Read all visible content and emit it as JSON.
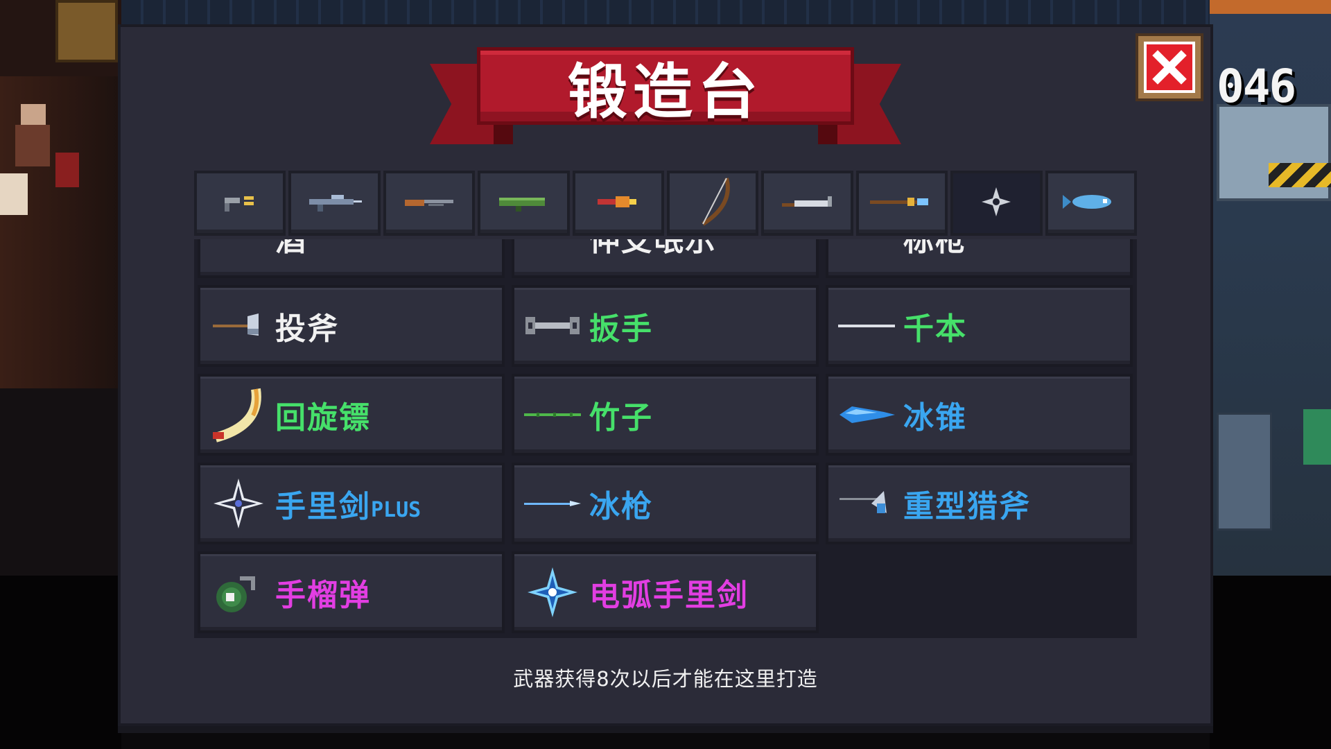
{
  "background": {
    "counter_text": "046"
  },
  "title": "锻造台",
  "close_icon": "close-x-icon",
  "tabs": [
    {
      "icon": "pistol-icon",
      "active": false
    },
    {
      "icon": "rifle-icon",
      "active": false
    },
    {
      "icon": "shotgun-icon",
      "active": false
    },
    {
      "icon": "launcher-icon",
      "active": false
    },
    {
      "icon": "staff-icon",
      "active": false
    },
    {
      "icon": "bow-icon",
      "active": false
    },
    {
      "icon": "sword-icon",
      "active": false
    },
    {
      "icon": "spear-icon",
      "active": false
    },
    {
      "icon": "shuriken-icon",
      "active": true
    },
    {
      "icon": "fish-icon",
      "active": false
    }
  ],
  "weapons": [
    {
      "name": "酒",
      "color": "white",
      "icon": "wine-icon"
    },
    {
      "name": "伸支氓示",
      "color": "white",
      "icon": "paper-icon"
    },
    {
      "name": "标枪",
      "color": "white",
      "icon": "javelin-icon"
    },
    {
      "name": "投斧",
      "color": "white",
      "icon": "throwing-axe-icon"
    },
    {
      "name": "扳手",
      "color": "green",
      "icon": "wrench-icon"
    },
    {
      "name": "千本",
      "color": "green",
      "icon": "senbon-icon"
    },
    {
      "name": "回旋镖",
      "color": "green",
      "icon": "boomerang-icon"
    },
    {
      "name": "竹子",
      "color": "green",
      "icon": "bamboo-icon"
    },
    {
      "name": "冰锥",
      "color": "blue",
      "icon": "ice-spike-icon"
    },
    {
      "name": "手里剑",
      "suffix": "PLUS",
      "color": "blue",
      "icon": "shuriken-plus-icon"
    },
    {
      "name": "冰枪",
      "color": "blue",
      "icon": "ice-spear-icon"
    },
    {
      "name": "重型猎斧",
      "color": "blue",
      "icon": "heavy-axe-icon"
    },
    {
      "name": "手榴弹",
      "color": "purple",
      "icon": "grenade-icon"
    },
    {
      "name": "电弧手里剑",
      "color": "purple",
      "icon": "arc-shuriken-icon"
    }
  ],
  "footer_note": "武器获得8次以后才能在这里打造",
  "colors": {
    "panel_bg": "#2b2b38",
    "banner_red": "#b11a2c",
    "close_red": "#e3202a",
    "rarity_white": "#f1f1f1",
    "rarity_green": "#46e06a",
    "rarity_blue": "#3aa6f0",
    "rarity_purple": "#e23ee2"
  }
}
